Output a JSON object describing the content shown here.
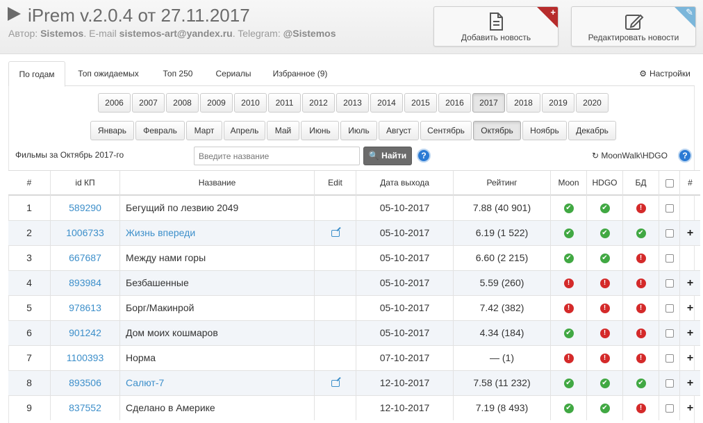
{
  "header": {
    "title": "iPrem v.2.0.4 от 27.11.2017",
    "author_prefix": "Автор: ",
    "author": "Sistemos",
    "email_prefix": ". E-mail ",
    "email": "sistemos-art@yandex.ru",
    "telegram_prefix": ". Telegram: ",
    "telegram": "@Sistemos",
    "add_news": "Добавить новость",
    "edit_news": "Редактировать новости"
  },
  "tabs": [
    {
      "label": "По годам",
      "active": true
    },
    {
      "label": "Топ ожидаемых"
    },
    {
      "label": "Топ 250"
    },
    {
      "label": "Сериалы"
    },
    {
      "label": "Избранное (9)"
    }
  ],
  "settings_label": "Настройки",
  "years": [
    "2006",
    "2007",
    "2008",
    "2009",
    "2010",
    "2011",
    "2012",
    "2013",
    "2014",
    "2015",
    "2016",
    "2017",
    "2018",
    "2019",
    "2020"
  ],
  "selected_year": "2017",
  "months": [
    "Январь",
    "Февраль",
    "Март",
    "Апрель",
    "Май",
    "Июнь",
    "Июль",
    "Август",
    "Сентябрь",
    "Октябрь",
    "Ноябрь",
    "Декабрь"
  ],
  "selected_month": "Октябрь",
  "films_label": "Фильмы за Октябрь 2017-го",
  "search": {
    "placeholder": "Введите название",
    "button": "Найти"
  },
  "source_link": "MoonWalk\\HDGO",
  "table": {
    "headers": [
      "#",
      "id КП",
      "Название",
      "Edit",
      "Дата выхода",
      "Рейтинг",
      "Moon",
      "HDGO",
      "БД",
      "",
      "#"
    ],
    "rows": [
      {
        "n": "1",
        "id": "589290",
        "title": "Бегущий по лезвию 2049",
        "title_link": false,
        "edit": false,
        "date": "05-10-2017",
        "rating": "7.88  (40 901)",
        "moon": "ok",
        "hdgo": "ok",
        "db": "err",
        "plus": false
      },
      {
        "n": "2",
        "id": "1006733",
        "title": "Жизнь впереди",
        "title_link": true,
        "edit": true,
        "date": "05-10-2017",
        "rating": "6.19  (1 522)",
        "moon": "ok",
        "hdgo": "ok",
        "db": "ok",
        "plus": true
      },
      {
        "n": "3",
        "id": "667687",
        "title": "Между нами горы",
        "title_link": false,
        "edit": false,
        "date": "05-10-2017",
        "rating": "6.60  (2 215)",
        "moon": "ok",
        "hdgo": "ok",
        "db": "err",
        "plus": false
      },
      {
        "n": "4",
        "id": "893984",
        "title": "Безбашенные",
        "title_link": false,
        "edit": false,
        "date": "05-10-2017",
        "rating": "5.59  (260)",
        "moon": "err",
        "hdgo": "err",
        "db": "err",
        "plus": true
      },
      {
        "n": "5",
        "id": "978613",
        "title": "Борг/Макинрой",
        "title_link": false,
        "edit": false,
        "date": "05-10-2017",
        "rating": "7.42  (382)",
        "moon": "err",
        "hdgo": "err",
        "db": "err",
        "plus": true
      },
      {
        "n": "6",
        "id": "901242",
        "title": "Дом моих кошмаров",
        "title_link": false,
        "edit": false,
        "date": "05-10-2017",
        "rating": "4.34  (184)",
        "moon": "ok",
        "hdgo": "err",
        "db": "err",
        "plus": true
      },
      {
        "n": "7",
        "id": "1100393",
        "title": "Норма",
        "title_link": false,
        "edit": false,
        "date": "07-10-2017",
        "rating": "— (1)",
        "moon": "err",
        "hdgo": "err",
        "db": "err",
        "plus": true
      },
      {
        "n": "8",
        "id": "893506",
        "title": "Салют-7",
        "title_link": true,
        "edit": true,
        "date": "12-10-2017",
        "rating": "7.58  (11 232)",
        "moon": "ok",
        "hdgo": "ok",
        "db": "ok",
        "plus": true
      },
      {
        "n": "9",
        "id": "837552",
        "title": "Сделано в Америке",
        "title_link": false,
        "edit": false,
        "date": "12-10-2017",
        "rating": "7.19  (8 493)",
        "moon": "ok",
        "hdgo": "ok",
        "db": "err",
        "plus": true
      }
    ]
  },
  "colors": {
    "accent": "#3d8fca",
    "ok": "#41a843",
    "error": "#d42a2a",
    "corner_red": "#b72c2c",
    "corner_blue": "#7bb6da"
  },
  "icons": {
    "play": "play-icon",
    "add": "document-icon",
    "edit": "edit-document-icon",
    "settings": "gear-icon",
    "search": "search-icon",
    "help": "question-icon",
    "refresh": "refresh-icon"
  }
}
